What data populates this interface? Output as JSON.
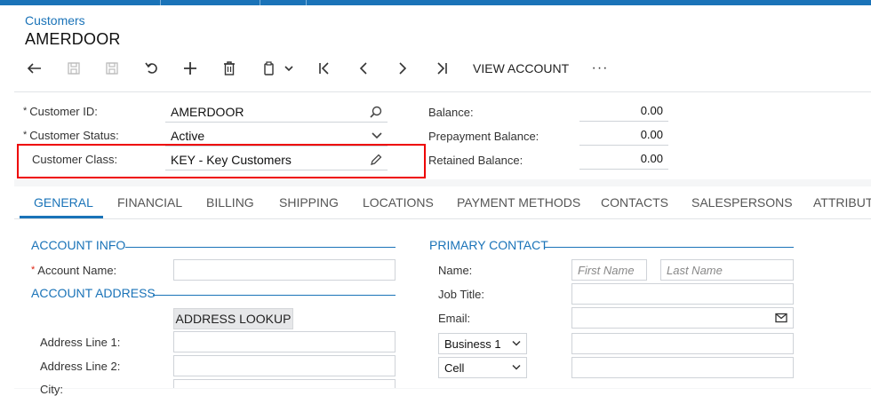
{
  "header": {
    "breadcrumb": "Customers",
    "title": "AMERDOOR"
  },
  "toolbar": {
    "view_account_label": "VIEW ACCOUNT",
    "more_label": "···"
  },
  "summary": {
    "customer_id_label": "Customer ID:",
    "customer_id_value": "AMERDOOR",
    "customer_status_label": "Customer Status:",
    "customer_status_value": "Active",
    "customer_class_label": "Customer Class:",
    "customer_class_value": "KEY - Key Customers",
    "balance_label": "Balance:",
    "balance_value": "0.00",
    "prepayment_balance_label": "Prepayment Balance:",
    "prepayment_balance_value": "0.00",
    "retained_balance_label": "Retained Balance:",
    "retained_balance_value": "0.00"
  },
  "tabs": [
    "GENERAL",
    "FINANCIAL",
    "BILLING",
    "SHIPPING",
    "LOCATIONS",
    "PAYMENT METHODS",
    "CONTACTS",
    "SALESPERSONS",
    "ATTRIBUTI"
  ],
  "account_info": {
    "section_title": "ACCOUNT INFO",
    "account_name_label": "Account Name:",
    "account_name_value": ""
  },
  "account_address": {
    "section_title": "ACCOUNT ADDRESS",
    "lookup_label": "ADDRESS LOOKUP",
    "line1_label": "Address Line 1:",
    "line2_label": "Address Line 2:",
    "city_label": "City:"
  },
  "primary_contact": {
    "section_title": "PRIMARY CONTACT",
    "name_label": "Name:",
    "first_name_placeholder": "First Name",
    "last_name_placeholder": "Last Name",
    "job_title_label": "Job Title:",
    "email_label": "Email:",
    "phone1_type": "Business 1",
    "phone2_type": "Cell"
  },
  "colors": {
    "accent": "#1a73b8",
    "highlight": "#e00000"
  }
}
